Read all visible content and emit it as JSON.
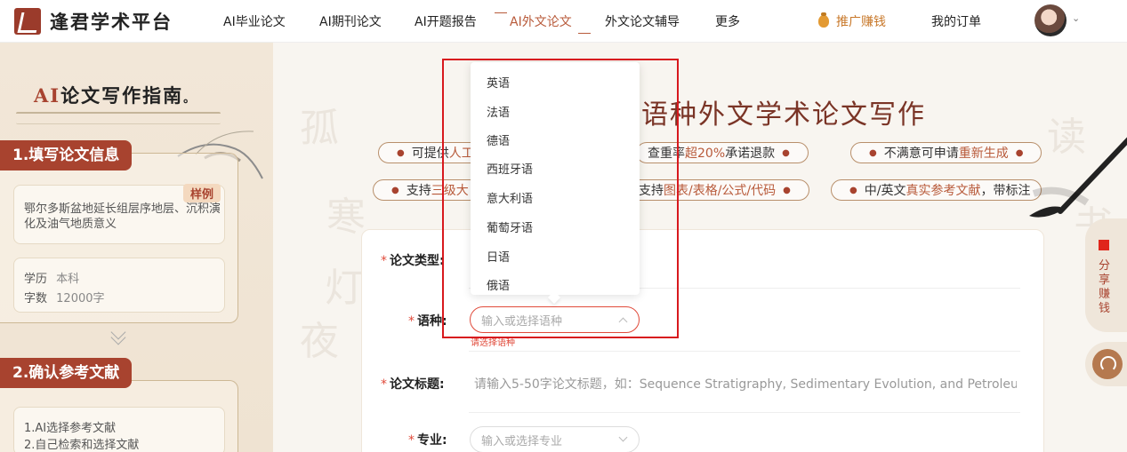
{
  "brand": {
    "name": "逢君学术平台"
  },
  "nav": {
    "items": [
      "AI毕业论文",
      "AI期刊论文",
      "AI开题报告",
      "AI外文论文",
      "外文论文辅导",
      "更多"
    ],
    "active": "AI外文论文",
    "promo": "推广赚钱",
    "orders": "我的订单"
  },
  "guide": {
    "title_ai": "AI",
    "title_rest": "论文写作指南",
    "title_dot": "。",
    "step1": {
      "label": "1.填写论文信息",
      "sample_badge": "样例",
      "sample_title": "鄂尔多斯盆地延长组层序地层、沉积演化及油气地质意义",
      "degree_label": "学历",
      "degree_value": "本科",
      "words_label": "字数",
      "words_value": "12000字"
    },
    "step2": {
      "label": "2.确认参考文献",
      "line1": "1.AI选择参考文献",
      "line2": "2.自己检索和选择文献"
    }
  },
  "main": {
    "heading": "语种外文学术论文写作",
    "pills_row1": [
      {
        "pre": "可提供",
        "hl": "人工",
        "post": ""
      },
      {
        "pre": "查重率",
        "hl": "超20%",
        "post": "承诺退款"
      },
      {
        "pre": "不满意可申请",
        "hl": "重新生成",
        "post": ""
      }
    ],
    "pills_row2": [
      {
        "pre": "支持",
        "hl": "三级大",
        "post": ""
      },
      {
        "pre": "支持",
        "hl": "图表/表格/公式/代码",
        "post": ""
      },
      {
        "pre": "中/英文",
        "hl": "真实参考文献",
        "post": "，带标注"
      }
    ]
  },
  "form": {
    "type_label": "论文类型:",
    "lang_label": "语种:",
    "lang_placeholder": "输入或选择语种",
    "lang_error": "请选择语种",
    "title_label": "论文标题:",
    "title_placeholder": "请输入5-50字论文标题，如：Sequence Stratigraphy, Sedimentary Evolution, and Petroleu",
    "major_label": "专业:",
    "major_placeholder": "输入或选择专业"
  },
  "dropdown": {
    "options": [
      "英语",
      "法语",
      "德语",
      "西班牙语",
      "意大利语",
      "葡萄牙语",
      "日语",
      "俄语"
    ]
  },
  "sidebar_widget": {
    "share_text": "分享赚钱"
  },
  "colors": {
    "brand": "#a8432f",
    "accent": "#b85a3a",
    "error": "#e04a3a",
    "highlight_box": "#d8191e"
  }
}
